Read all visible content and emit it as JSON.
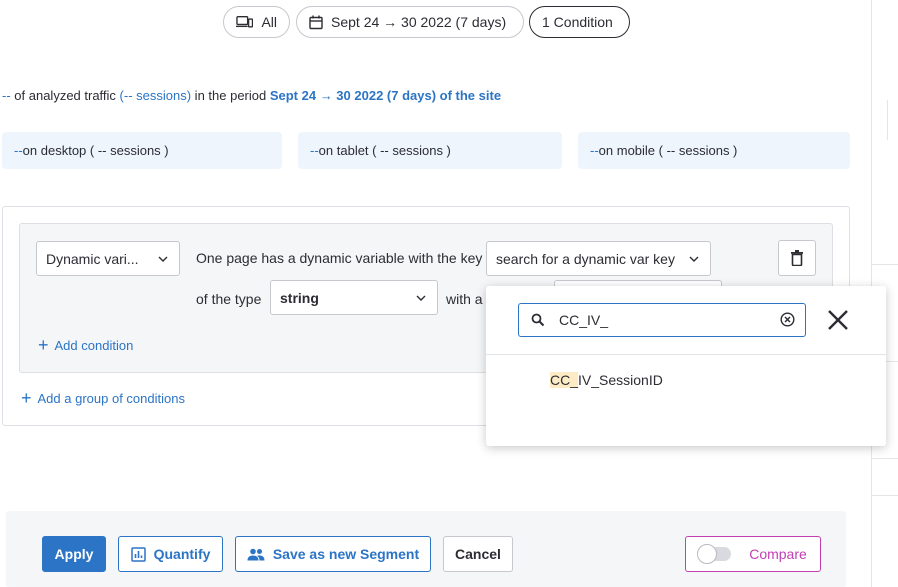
{
  "filters": {
    "device_label": "All",
    "date_range_label": "Sept 24 → 30 2022 (7 days)",
    "conditions_label": "1 Condition"
  },
  "traffic": {
    "prefix": "--",
    "text1": " of analyzed traffic ",
    "sessions": "(-- sessions)",
    "text2": " in the period ",
    "period": "Sept 24 → 30 2022 (7 days) of the site"
  },
  "devices": [
    {
      "value": "--",
      "label": " on desktop ( -- sessions )"
    },
    {
      "value": "--",
      "label": " on tablet ( -- sessions )"
    },
    {
      "value": "--",
      "label": " on mobile ( -- sessions )"
    }
  ],
  "condition": {
    "type_select": "Dynamic vari...",
    "sentence_1": "One page has a dynamic variable with the key",
    "key_select": "search for a dynamic var key",
    "sentence_2": "of the type",
    "type_value": "string",
    "sentence_3": "with a",
    "add_condition": "Add condition",
    "add_group": "Add a group of conditions"
  },
  "dropdown": {
    "search_value": "CC_IV_",
    "option_match": "CC_",
    "option_rest": "IV_SessionID"
  },
  "actions": {
    "apply": "Apply",
    "quantify": "Quantify",
    "save_segment": "Save as new Segment",
    "cancel": "Cancel",
    "compare": "Compare"
  },
  "colors": {
    "accent": "#2b74c6",
    "compare": "#c23fb3",
    "highlight": "#fcebc4"
  }
}
